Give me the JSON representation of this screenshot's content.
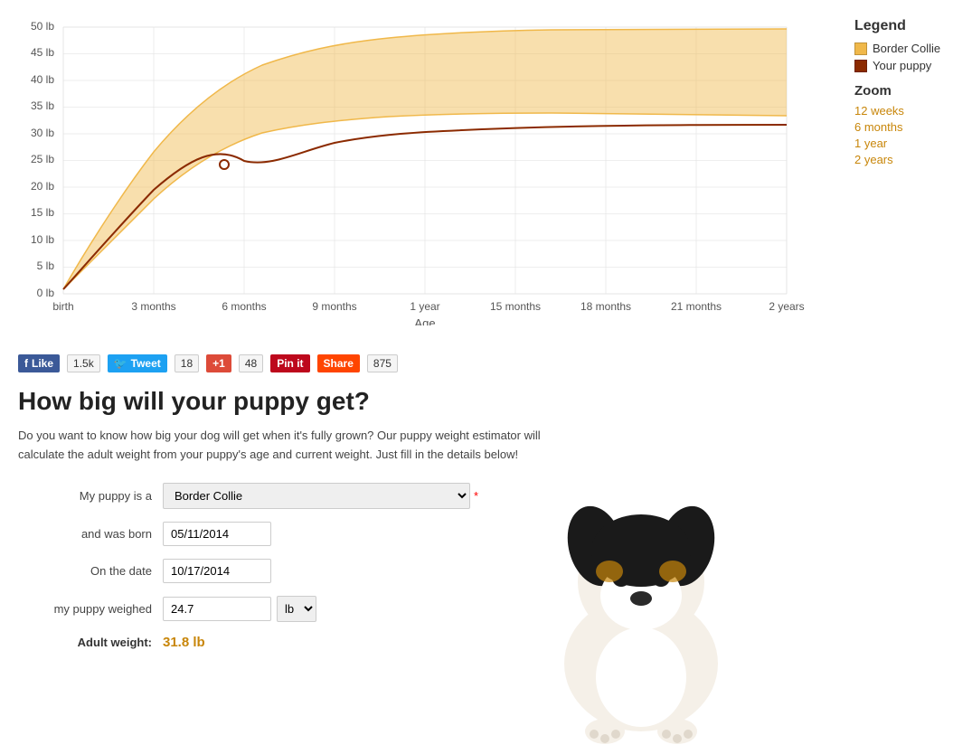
{
  "legend": {
    "title": "Legend",
    "items": [
      {
        "label": "Border Collie",
        "color": "#f0b84a"
      },
      {
        "label": "Your puppy",
        "color": "#8b2a00"
      }
    ]
  },
  "zoom": {
    "title": "Zoom",
    "links": [
      {
        "label": "12 weeks"
      },
      {
        "label": "6 months"
      },
      {
        "label": "1 year"
      },
      {
        "label": "2 years"
      }
    ]
  },
  "chart": {
    "x_labels": [
      "birth",
      "3 months",
      "6 months",
      "9 months",
      "1 year",
      "15 months",
      "18 months",
      "21 months",
      "2 years"
    ],
    "y_labels": [
      "0 lb",
      "5 lb",
      "10 lb",
      "15 lb",
      "20 lb",
      "25 lb",
      "30 lb",
      "35 lb",
      "40 lb",
      "45 lb",
      "50 lb"
    ],
    "x_axis_title": "Age"
  },
  "social": {
    "fb_label": "Like",
    "fb_count": "1.5k",
    "tw_label": "Tweet",
    "tw_count": "18",
    "gp_label": "+1",
    "gp_count": "48",
    "pin_label": "Pin it",
    "sh_label": "Share",
    "sh_count": "875"
  },
  "page": {
    "heading": "How big will your puppy get?",
    "description": "Do you want to know how big your dog will get when it's fully grown? Our puppy weight estimator will calculate the adult weight from your puppy's age and current weight. Just fill in the details below!"
  },
  "form": {
    "breed_label": "My puppy is a",
    "breed_value": "Border Collie",
    "born_label": "and was born",
    "born_value": "05/11/2014",
    "date_label": "On the date",
    "date_value": "10/17/2014",
    "weight_label": "my puppy weighed",
    "weight_value": "24.7",
    "weight_unit": "lb",
    "adult_label": "Adult weight:",
    "adult_value": "31.8 lb"
  }
}
